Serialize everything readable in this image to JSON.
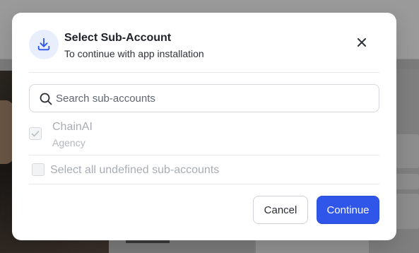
{
  "modal": {
    "title": "Select Sub-Account",
    "subtitle": "To continue with app installation",
    "header_icon": "download-tray-icon",
    "close_icon": "close-icon"
  },
  "search": {
    "placeholder": "Search sub-accounts",
    "value": "",
    "icon": "search-icon"
  },
  "accounts": [
    {
      "name": "ChainAI",
      "type": "Agency",
      "checked": true,
      "disabled": true
    }
  ],
  "select_all": {
    "label": "Select all undefined sub-accounts",
    "checked": false
  },
  "buttons": {
    "cancel": "Cancel",
    "continue": "Continue"
  },
  "colors": {
    "primary": "#2f56e8",
    "icon_bg": "#e8eefc",
    "icon_stroke": "#2f56e8",
    "disabled_text": "#a9adb3"
  }
}
